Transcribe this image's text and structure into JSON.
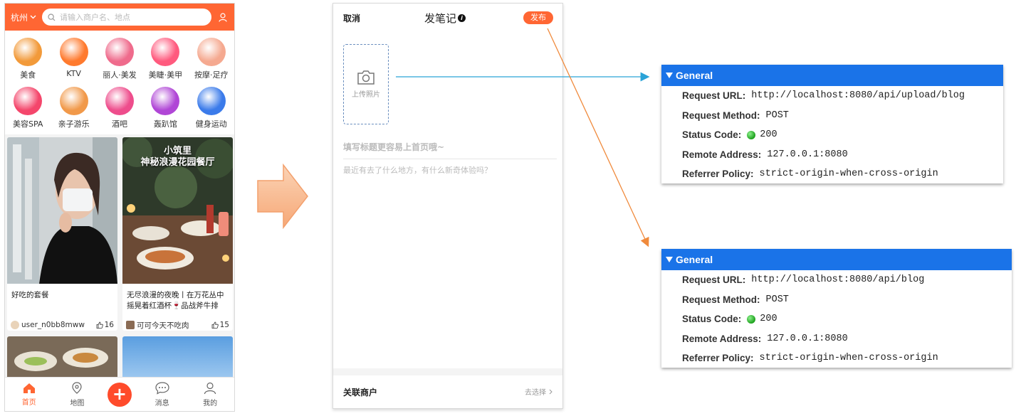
{
  "app": {
    "city": "杭州",
    "search_placeholder": "请输入商户名、地点",
    "categories": [
      {
        "label": "美食",
        "icon": "roast-chicken-icon",
        "color": "#f29a3a"
      },
      {
        "label": "KTV",
        "icon": "microphone-icon",
        "color": "#ff7a2e"
      },
      {
        "label": "丽人·美发",
        "icon": "hair-icon",
        "color": "#ef6b8c"
      },
      {
        "label": "美睫·美甲",
        "icon": "nail-icon",
        "color": "#ff5a7e"
      },
      {
        "label": "按摩·足疗",
        "icon": "massage-icon",
        "color": "#f5a990"
      },
      {
        "label": "美容SPA",
        "icon": "face-mask-icon",
        "color": "#f4466b"
      },
      {
        "label": "亲子游乐",
        "icon": "parent-child-icon",
        "color": "#f1994a"
      },
      {
        "label": "酒吧",
        "icon": "cocktail-icon",
        "color": "#ee4d8c"
      },
      {
        "label": "轰趴馆",
        "icon": "party-mask-icon",
        "color": "#b046d6"
      },
      {
        "label": "健身运动",
        "icon": "dumbbell-icon",
        "color": "#3b7bea"
      }
    ],
    "posts": [
      {
        "title": "好吃的套餐",
        "author": "user_n0bb8mww",
        "likes": "16"
      },
      {
        "title": "无尽浪漫的夜晚丨在万花丛中摇晃着红酒杯🍷品战斧牛排",
        "author": "可可今天不吃肉",
        "likes": "15"
      }
    ],
    "post_overlay_title": "小筑里\n神秘浪漫花园餐厅",
    "tabs": [
      {
        "label": "首页",
        "icon": "home-icon"
      },
      {
        "label": "地图",
        "icon": "map-pin-icon"
      },
      {
        "label": "",
        "icon": "add-icon"
      },
      {
        "label": "消息",
        "icon": "message-icon"
      },
      {
        "label": "我的",
        "icon": "profile-icon"
      }
    ]
  },
  "editor": {
    "cancel": "取消",
    "title": "发笔记",
    "publish": "发布",
    "upload_label": "上传照片",
    "title_placeholder": "填写标题更容易上首页哦~",
    "body_placeholder": "最近有去了什么地方，有什么新奇体验吗？",
    "shop_label": "关联商户",
    "shop_action": "去选择"
  },
  "panels": [
    {
      "header": "General",
      "rows": [
        {
          "key": "Request URL:",
          "value": "http://localhost:8080/api/upload/blog"
        },
        {
          "key": "Request Method:",
          "value": "POST"
        },
        {
          "key": "Status Code:",
          "value": "200"
        },
        {
          "key": "Remote Address:",
          "value": "127.0.0.1:8080"
        },
        {
          "key": "Referrer Policy:",
          "value": "strict-origin-when-cross-origin"
        }
      ]
    },
    {
      "header": "General",
      "rows": [
        {
          "key": "Request URL:",
          "value": "http://localhost:8080/api/blog"
        },
        {
          "key": "Request Method:",
          "value": "POST"
        },
        {
          "key": "Status Code:",
          "value": "200"
        },
        {
          "key": "Remote Address:",
          "value": "127.0.0.1:8080"
        },
        {
          "key": "Referrer Policy:",
          "value": "strict-origin-when-cross-origin"
        }
      ]
    }
  ],
  "colors": {
    "brand": "#ff6633",
    "devtools_header": "#1a73e8",
    "arrow_blue": "#2aa3d8",
    "arrow_orange": "#f08a3c",
    "status_ok": "#22aa22"
  }
}
